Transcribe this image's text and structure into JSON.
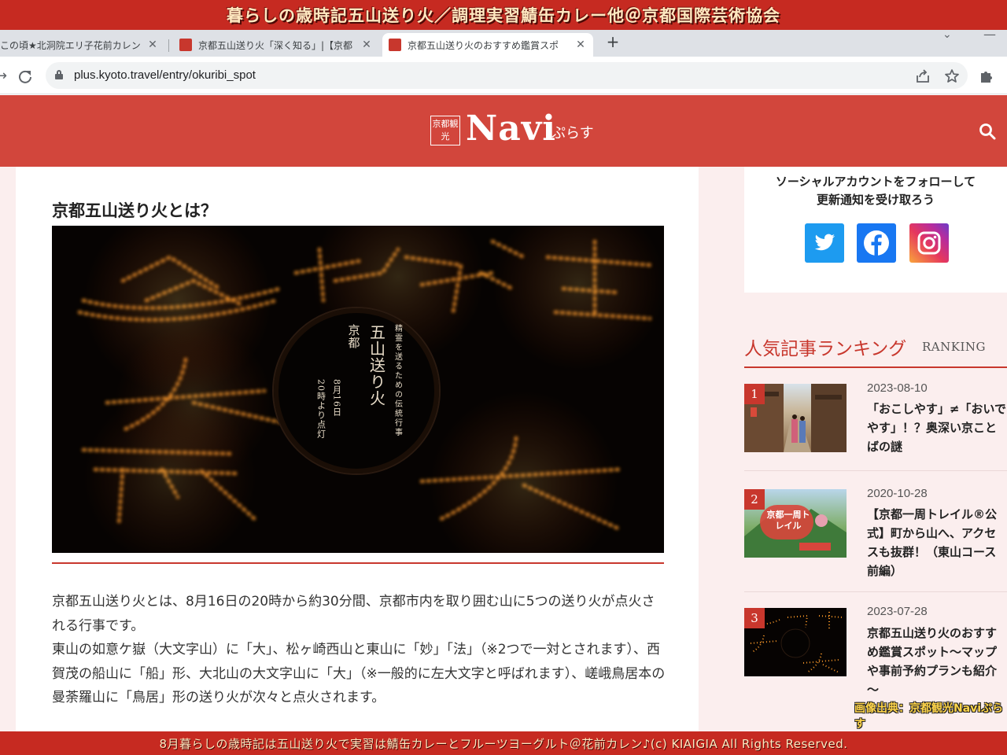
{
  "banner": {
    "top": "暮らしの歳時記五山送り火／調理実習鯖缶カレー他＠京都国際芸術協会",
    "bottom": "8月暮らしの歳時記は五山送り火で実習は鯖缶カレーとフルーツヨーグルト＠花前カレン♪(c) KIAIGIA All Rights Reserved."
  },
  "browser": {
    "tabs": [
      {
        "label": "この頃★北洞院エリ子花前カレン",
        "active": false
      },
      {
        "label": "京都五山送り火「深く知る」|【京都",
        "active": false
      },
      {
        "label": "京都五山送り火のおすすめ鑑賞スポ",
        "active": true
      }
    ],
    "tab_close": "✕",
    "new_tab": "+",
    "url": "plus.kyoto.travel/entry/okuribi_spot"
  },
  "site": {
    "logo_box": "京都観光",
    "logo_main": "Navi",
    "logo_sub": "ぷらす"
  },
  "article": {
    "section_title": "京都五山送り火とは？",
    "hero_caption": {
      "line1": "精霊を送るための伝統行事",
      "line2": "京都",
      "line3": "五山送り火",
      "line4": "8月16日",
      "line5": "20時より点灯"
    },
    "paragraphs": [
      "京都五山送り火とは、8月16日の20時から約30分間、京都市内を取り囲む山に5つの送り火が点火される行事です。",
      "東山の如意ケ嶽（大文字山）に「大」、松ヶ崎西山と東山に「妙」「法」（※2つで一対とされます）、西賀茂の船山に「船」形、大北山の大文字山に「大」（※一般的に左大文字と呼ばれます）、嵯峨鳥居本の曼荼羅山に「鳥居」形の送り火が次々と点火されます。"
    ]
  },
  "sidebar": {
    "social_text_line1": "ソーシャルアカウントをフォローして",
    "social_text_line2": "更新通知を受け取ろう",
    "ranking_title": "人気記事ランキング",
    "ranking_en": "RANKING",
    "ranking": [
      {
        "num": "1",
        "date": "2023-08-10",
        "title": "「おこしやす」≠「おいでやす」！？奥深い京ことばの謎"
      },
      {
        "num": "2",
        "date": "2020-10-28",
        "title": "【京都一周トレイル®公式】町から山へ、アクセスも抜群！（東山コース前編）",
        "thumb_text": "京都一周トレイル"
      },
      {
        "num": "3",
        "date": "2023-07-28",
        "title": "京都五山送り火のおすすめ鑑賞スポット～マップや事前予約プランも紹介～"
      }
    ]
  },
  "credit": "画像出典：京都観光Naviぷらす",
  "colors": {
    "banner": "#c62a21",
    "site_header": "#d2463c",
    "accent": "#c8372d",
    "page_bg": "#fbeeee"
  },
  "icons": {
    "back": "arrow-left-icon",
    "reload": "reload-icon",
    "lock": "lock-icon",
    "share": "share-icon",
    "bookmark": "star-icon",
    "extensions": "puzzle-icon",
    "search": "search-icon"
  }
}
